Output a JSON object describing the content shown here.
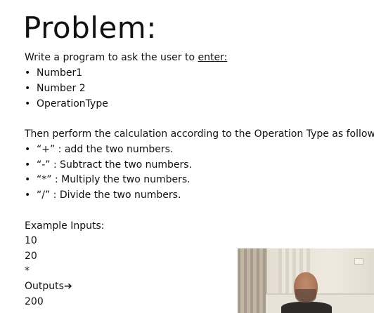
{
  "slide": {
    "title": "Problem:",
    "intro": {
      "prefix": "Write a program to ask the user to ",
      "underlined": "enter:"
    },
    "inputs": [
      "Number1",
      "Number 2",
      "OperationType"
    ],
    "bullet_symbol": "•",
    "operations_intro": "Then perform the calculation according to the Operation Type as follows:",
    "operations": [
      "“+” : add the two numbers.",
      "“-” : Subtract the two numbers.",
      "“*” : Multiply the two numbers.",
      "“/” : Divide the two numbers."
    ],
    "example_label": "Example Inputs:",
    "example_values": [
      "10",
      "20",
      "*"
    ],
    "outputs_label": "Outputs",
    "outputs_arrow": "➔",
    "output_value": "200"
  }
}
